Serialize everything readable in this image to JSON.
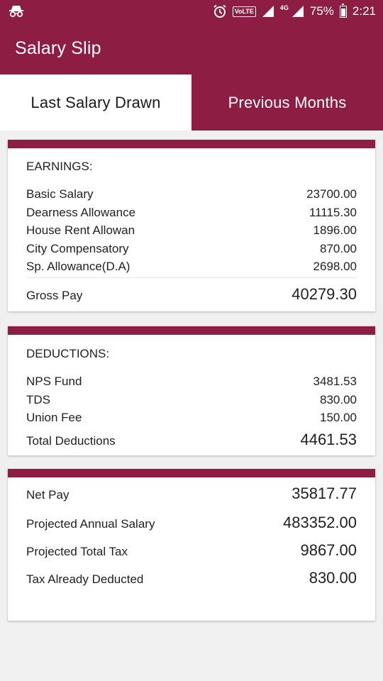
{
  "status_bar": {
    "battery": "75%",
    "time": "2:21",
    "volte_label": "VoLTE",
    "network_type": "4G",
    "icons": [
      "incognito-icon",
      "alarm-icon",
      "signal-icon",
      "battery-icon"
    ]
  },
  "app_bar": {
    "title": "Salary Slip"
  },
  "tabs": [
    {
      "label": "Last Salary Drawn",
      "active": true
    },
    {
      "label": "Previous Months",
      "active": false
    }
  ],
  "earnings": {
    "title": "EARNINGS:",
    "items": [
      {
        "label": "Basic Salary",
        "amount": "23700.00"
      },
      {
        "label": "Dearness Allowance",
        "amount": "11115.30"
      },
      {
        "label": "House Rent Allowan",
        "amount": "1896.00"
      },
      {
        "label": "City Compensatory",
        "amount": "870.00"
      },
      {
        "label": "Sp. Allowance(D.A)",
        "amount": "2698.00"
      }
    ],
    "total_label": "Gross Pay",
    "total_amount": "40279.30"
  },
  "deductions": {
    "title": "DEDUCTIONS:",
    "items": [
      {
        "label": "NPS Fund",
        "amount": "3481.53"
      },
      {
        "label": "TDS",
        "amount": "830.00"
      },
      {
        "label": "Union Fee",
        "amount": "150.00"
      }
    ],
    "total_label": "Total Deductions",
    "total_amount": "4461.53"
  },
  "summary": [
    {
      "label": "Net Pay",
      "amount": "35817.77"
    },
    {
      "label": "Projected Annual Salary",
      "amount": "483352.00"
    },
    {
      "label": "Projected Total Tax",
      "amount": "9867.00"
    },
    {
      "label": "Tax Already Deducted",
      "amount": "830.00"
    }
  ],
  "colors": {
    "primary": "#8e1d43",
    "background": "#f0f0f0",
    "card": "#ffffff"
  }
}
